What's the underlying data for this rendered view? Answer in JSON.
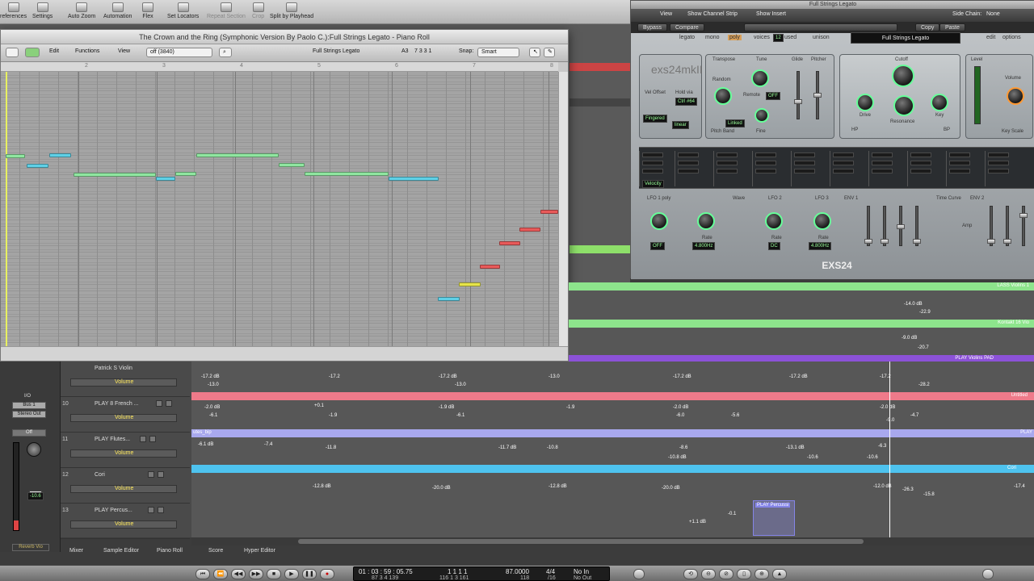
{
  "toolbar": {
    "items": [
      "references",
      "Settings",
      "Auto Zoom",
      "Automation",
      "Flex",
      "Set Locators",
      "Repeat Section",
      "Crop",
      "Split by Playhead"
    ]
  },
  "piano_roll": {
    "title": "The Crown and the Ring (Symphonic Version By Paolo C.):Full Strings Legato - Piano Roll",
    "menu": {
      "edit": "Edit",
      "functions": "Functions",
      "view": "View"
    },
    "quantize": "off (3840)",
    "region_name": "Full Strings Legato",
    "pitch": "A3",
    "position": "7 3 3 1",
    "snap_label": "Snap:",
    "snap_value": "Smart",
    "ruler": [
      "2",
      "3",
      "4",
      "5",
      "6",
      "7",
      "8"
    ],
    "note_colors": {
      "cyan": "#5fd0e6",
      "green": "#8fe6a0",
      "yellow": "#e6e44a",
      "red": "#e85a5a"
    }
  },
  "exs": {
    "window_title": "Full Strings Legato",
    "menu": {
      "view": "View",
      "show_strip": "Show Channel Strip",
      "show_insert": "Show Insert",
      "side_chain_label": "Side Chain:",
      "side_chain_value": "None"
    },
    "buttons": {
      "bypass": "Bypass",
      "compare": "Compare",
      "copy": "Copy",
      "paste": "Paste",
      "edit": "edit",
      "options": "options"
    },
    "voice_modes": {
      "legato": "legato",
      "mono": "mono",
      "poly": "poly",
      "voices_label": "voices",
      "voices_value": "12",
      "used_label": "used",
      "unison": "unison"
    },
    "instrument_name": "Full Strings Legato",
    "logo": "exs24mkII",
    "labels": {
      "transpose": "Transpose",
      "tune": "Tune",
      "glide": "Glide",
      "pitcher": "Pitcher",
      "random": "Random",
      "remote": "Remote",
      "off": "OFF",
      "pitch_band": "Pitch  Band",
      "fine": "Fine",
      "linked": "Linked",
      "cutoff": "Cutoff",
      "drive": "Drive",
      "resonance": "Resonance",
      "key": "Key",
      "level": "Level",
      "volume": "Volume",
      "key_scale": "Key Scale",
      "velocity": "Velocity",
      "lfo1": "LFO 1 poly",
      "wave": "Wave",
      "lfo2": "LFO 2",
      "lfo3": "LFO 3",
      "env1": "ENV 1",
      "env2": "ENV 2",
      "time_curve": "Time Curve",
      "amp": "Amp",
      "rate": "Rate",
      "hp": "HP",
      "bp": "BP"
    },
    "lcds": {
      "velocity_offset": "Vel Offset",
      "hold_via": "Hold via",
      "ctrl": "Ctrl #64",
      "fingered": "Fingered",
      "linear": "linear",
      "lfo1_rate": "4.800Hz",
      "lfo2_rate": "DC",
      "lfo3_rate": "4.800Hz",
      "off": "OFF"
    },
    "footer_name": "EXS24"
  },
  "tracks": [
    {
      "num": "",
      "name": "Patrick S Violin",
      "param": "Volume",
      "color": "#9a9a9a",
      "region": "",
      "autos": [
        "-17.2 dB",
        "-13.0",
        "-17.2",
        "-17.2 dB",
        "-13.0",
        "-13.0",
        "-17.2 dB",
        "-17.2 dB",
        "-17.2",
        "-28.2"
      ]
    },
    {
      "num": "10",
      "name": "PLAY 8 French ...",
      "param": "Volume",
      "color": "#ef7a8a",
      "region": "Untitled",
      "autos": [
        "-2.0 dB",
        "-6.1",
        "+0.1",
        "-1.9",
        "-1.9 dB",
        "-6.1",
        "-1.9",
        "-2.0 dB",
        "-6.0",
        "-5.6",
        "-2.0 dB",
        "-4.7",
        "-9.0"
      ]
    },
    {
      "num": "11",
      "name": "PLAY Flutes...",
      "param": "Volume",
      "color": "#a8a8ee",
      "region": "utes_bip",
      "autos": [
        "-6.1 dB",
        "-7.4",
        "-11.8",
        "-11.7 dB",
        "-10.8",
        "-8.6",
        "-10.8 dB",
        "-13.1 dB",
        "-10.6",
        "-6.3",
        "-10.6"
      ]
    },
    {
      "num": "12",
      "name": "Cori",
      "param": "Volume",
      "color": "#4ec3ef",
      "region": "Cori",
      "autos": [
        "-12.8 dB",
        "-20.0 dB",
        "-12.8 dB",
        "-20.0 dB",
        "-12.0 dB",
        "-26.3",
        "-15.8",
        "-17.4"
      ]
    },
    {
      "num": "13",
      "name": "PLAY Percus...",
      "param": "Volume",
      "color": "#8585e8",
      "region": "PLAY Percussi",
      "autos": [
        "-0.1",
        "+1.1 dB"
      ]
    }
  ],
  "arrange_labels": {
    "lass": "LASS Violins 1",
    "kontakt": "Kontakt 16 Vio",
    "play_violins": "PLAY Violins PAD",
    "untitled": "Untitled",
    "play": "PLAY",
    "cori": "Cori",
    "auto_lass": [
      "-14.0 dB",
      "-22.9"
    ],
    "auto_kontakt": [
      "-9.0 dB",
      "-20.7"
    ]
  },
  "channel_strip": {
    "io": "I/O",
    "bus": "Bus 1",
    "stereo_out": "Stereo Out",
    "off": "Off",
    "level": "-10.6",
    "name": "Reverb Vio"
  },
  "bottom_tabs": [
    "Mixer",
    "Sample Editor",
    "Piano Roll",
    "Score",
    "Hyper Editor"
  ],
  "transport": {
    "time": "01 : 03 : 59 : 05.75",
    "time_sub": "87   3   4   139",
    "bars": "1   1   1   1",
    "bars_sub": "116   1   3   161",
    "tempo": "87.0000",
    "tempo_sub": "118",
    "sig": "4/4",
    "sig_sub": "/16",
    "in": "No In",
    "out": "No Out"
  }
}
